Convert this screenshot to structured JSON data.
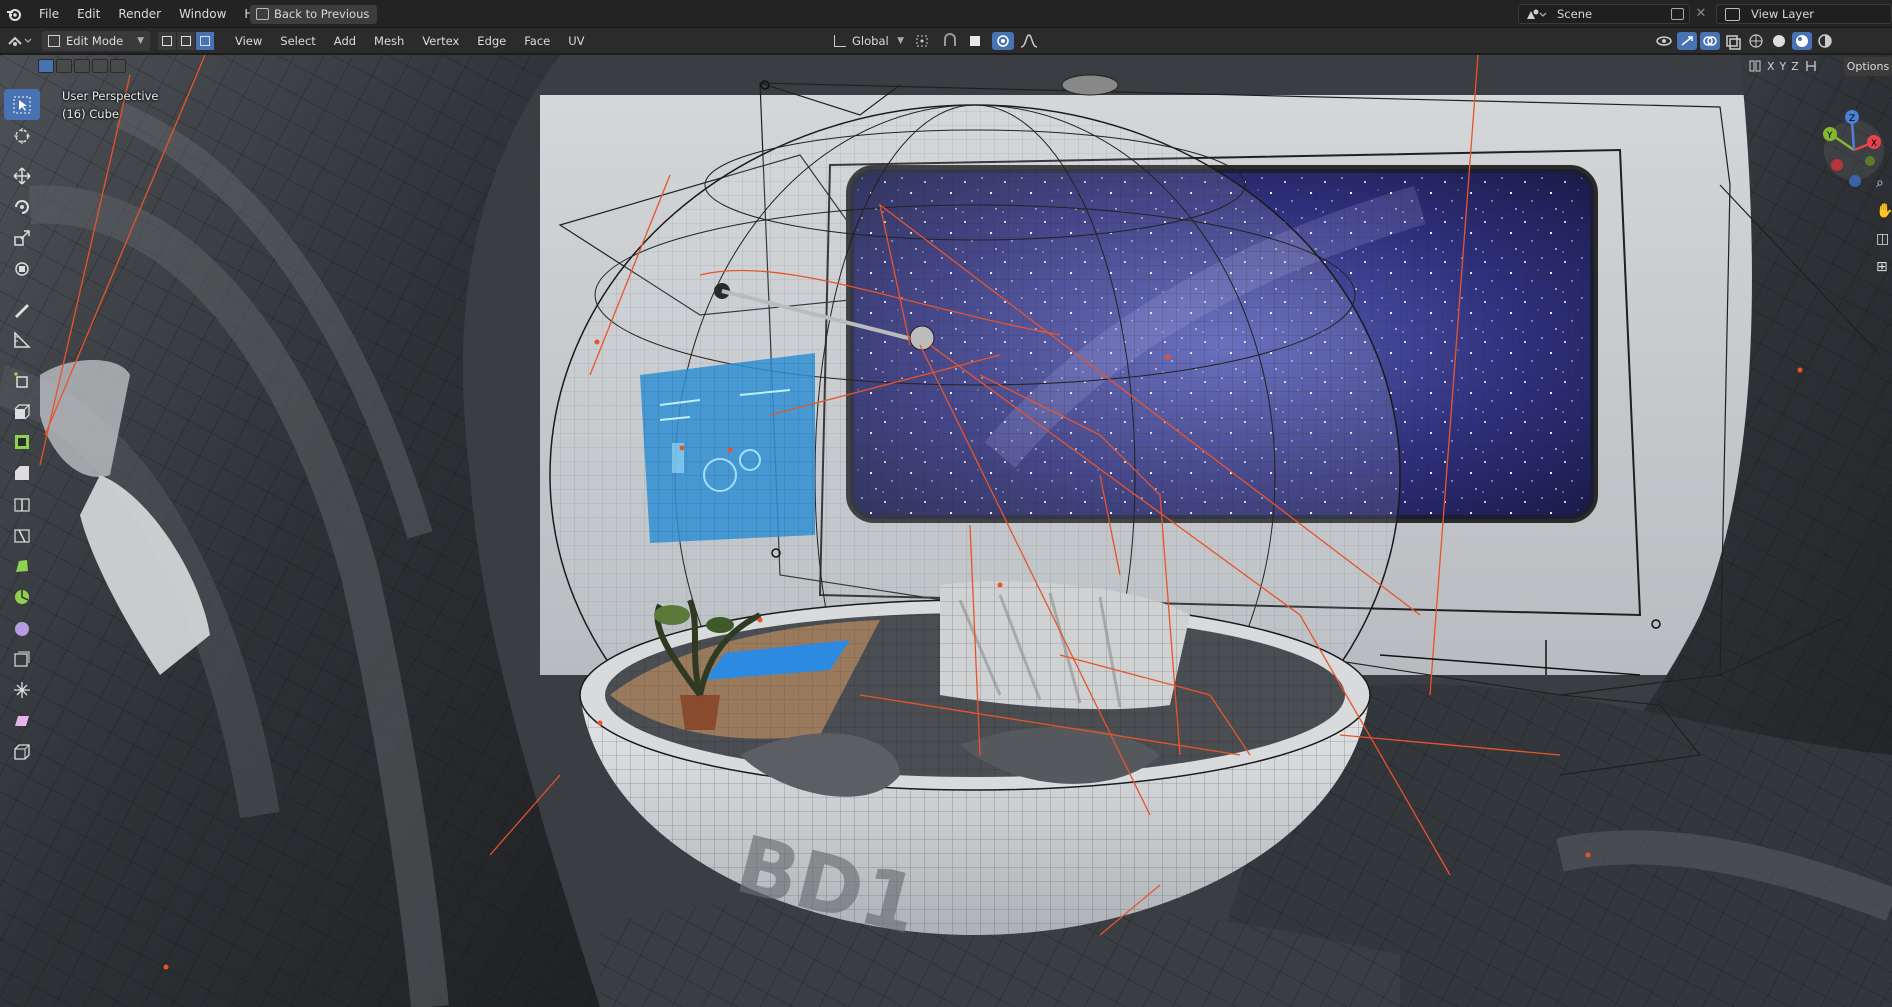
{
  "topbar": {
    "menu": [
      "File",
      "Edit",
      "Render",
      "Window",
      "Help"
    ],
    "back_button": "Back to Previous",
    "scene_name": "Scene",
    "view_layer": "View Layer"
  },
  "header": {
    "mode": "Edit Mode",
    "menu": [
      "View",
      "Select",
      "Add",
      "Mesh",
      "Vertex",
      "Edge",
      "Face",
      "UV"
    ],
    "orientation": "Global"
  },
  "viewport": {
    "view_name": "User Perspective",
    "object_name": "(16) Cube",
    "options_label": "Options",
    "axis_labels": [
      "X",
      "Y",
      "Z"
    ],
    "gizmo": {
      "x_color": "#e8424a",
      "y_color": "#85b733",
      "z_color": "#4d7fd6"
    },
    "hull_lettering": "BD1"
  },
  "toolbar": {
    "tools": [
      "select-box-icon",
      "cursor-icon",
      "move-icon",
      "rotate-icon",
      "scale-icon",
      "transform-icon",
      "annotate-icon",
      "measure-icon",
      "add-cube-icon",
      "extrude-icon",
      "inset-icon",
      "bevel-icon",
      "loop-cut-icon",
      "knife-icon",
      "poly-build-icon",
      "spin-icon",
      "smooth-icon",
      "edge-slide-icon",
      "shrink-fatten-icon",
      "shear-icon",
      "rip-region-icon"
    ]
  },
  "colors": {
    "accent": "#4772b3",
    "header_bg": "#2b2b2b",
    "topbar_bg": "#232323",
    "wire": "#1a1a1a",
    "edge_highlight": "#e8542a"
  }
}
